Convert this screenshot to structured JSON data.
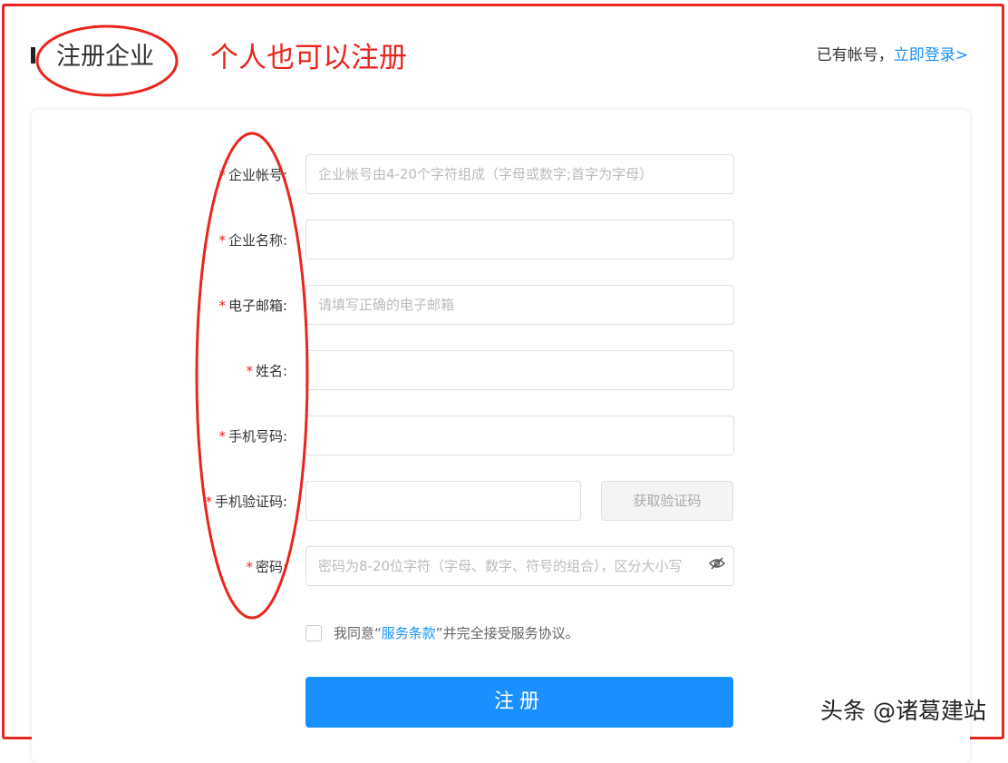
{
  "header": {
    "title": "注册企业",
    "annotation": "个人也可以注册",
    "login_prompt": "已有帐号，",
    "login_link": "立即登录>"
  },
  "form": {
    "fields": [
      {
        "label": "企业帐号:",
        "placeholder": "企业帐号由4-20个字符组成（字母或数字;首字为字母）"
      },
      {
        "label": "企业名称:",
        "placeholder": ""
      },
      {
        "label": "电子邮箱:",
        "placeholder": "请填写正确的电子邮箱"
      },
      {
        "label": "姓名:",
        "placeholder": ""
      },
      {
        "label": "手机号码:",
        "placeholder": ""
      },
      {
        "label": "手机验证码:",
        "placeholder": ""
      },
      {
        "label": "密码:",
        "placeholder": "密码为8-20位字符（字母、数字、符号的组合），区分大小写"
      }
    ],
    "required_mark": "*",
    "get_code_label": "获取验证码",
    "agree_prefix": "我同意“",
    "agree_link": "服务条款",
    "agree_suffix": "”并完全接受服务协议。",
    "submit_label": "注册"
  },
  "watermark": "头条 @诸葛建站",
  "colors": {
    "accent": "#1890ff",
    "annotation": "#e8261e"
  }
}
